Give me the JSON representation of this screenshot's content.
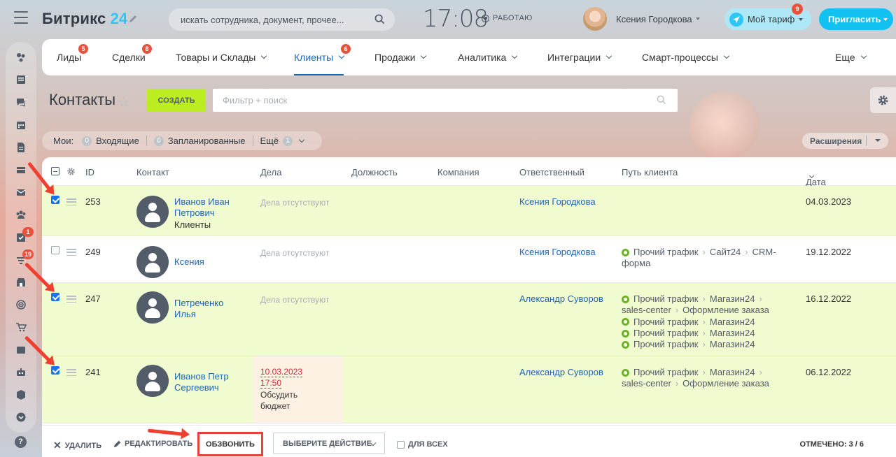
{
  "app": {
    "logo_text": "Битрикс",
    "logo_num": "24"
  },
  "search": {
    "placeholder": "искать сотрудника, документ, прочее..."
  },
  "clock": {
    "time": "17:08",
    "status": "РАБОТАЮ"
  },
  "user": {
    "name": "Ксения Городкова"
  },
  "tariff": {
    "label": "Мой тариф",
    "badge": "9"
  },
  "invite": {
    "label": "Пригласить"
  },
  "sidebar": {
    "badges": {
      "tasks": "1",
      "crm": "19"
    },
    "help": "?"
  },
  "menu": {
    "items": [
      {
        "label": "Лиды",
        "badge": "5"
      },
      {
        "label": "Сделки",
        "badge": "8"
      },
      {
        "label": "Товары и Склады"
      },
      {
        "label": "Клиенты",
        "badge": "6"
      },
      {
        "label": "Продажи"
      },
      {
        "label": "Аналитика"
      },
      {
        "label": "Интеграции"
      },
      {
        "label": "Смарт-процессы"
      },
      {
        "label": "Еще"
      }
    ]
  },
  "toolbar": {
    "title": "Контакты",
    "create": "СОЗДАТЬ",
    "filter_placeholder": "Фильтр + поиск"
  },
  "counters": {
    "mine": "Мои:",
    "incoming_count": "0",
    "incoming": "Входящие",
    "planned_count": "0",
    "planned": "Запланированные",
    "more": "Ещё",
    "more_count": "1"
  },
  "extensions": "Расширения",
  "grid": {
    "columns": {
      "id": "ID",
      "contact": "Контакт",
      "deals": "Дела",
      "position": "Должность",
      "company": "Компания",
      "responsible": "Ответственный",
      "path": "Путь клиента",
      "created": "Дата создания"
    },
    "rows": [
      {
        "id": "253",
        "name_1": "Иванов Иван",
        "name_2": "Петрович",
        "tag": "Клиенты",
        "deals": "Дела отсутствуют",
        "responsible": "Ксения Городкова",
        "created": "04.03.2023"
      },
      {
        "id": "249",
        "name_1": "Ксения",
        "deals": "Дела отсутствуют",
        "responsible": "Ксения Городкова",
        "path_1": "Прочий трафик",
        "path_2": "Сайт24",
        "path_3": "CRM-",
        "path_4": "форма",
        "created": "19.12.2022"
      },
      {
        "id": "247",
        "name_1": "Петреченко",
        "name_2": "Илья",
        "deals": "Дела отсутствуют",
        "responsible": "Александр Суворов",
        "path_a1": "Прочий трафик",
        "path_a2": "Магазин24",
        "path_a3": "sales-center",
        "path_a4": "Оформление заказа",
        "path_b1": "Прочий трафик",
        "path_b2": "Магазин24",
        "path_c1": "Прочий трафик",
        "path_c2": "Магазин24",
        "path_d1": "Прочий трафик",
        "path_d2": "Магазин24",
        "created": "16.12.2022"
      },
      {
        "id": "241",
        "name_1": "Иванов Петр",
        "name_2": "Сергеевич",
        "deal_date": "10.03.2023",
        "deal_time": "17:50",
        "deal_text_1": "Обсудить",
        "deal_text_2": "бюджет",
        "responsible": "Александр Суворов",
        "path_1": "Прочий трафик",
        "path_2": "Магазин24",
        "path_3": "sales-center",
        "path_4": "Оформление заказа",
        "created": "06.12.2022"
      }
    ]
  },
  "actions": {
    "delete": "УДАЛИТЬ",
    "edit": "РЕДАКТИРОВАТЬ",
    "call": "ОБЗВОНИТЬ",
    "choose": "ВЫБЕРИТЕ ДЕЙСТВИЕ",
    "for_all": "ДЛЯ ВСЕХ",
    "marked": "ОТМЕЧЕНО: 3 / 6"
  },
  "colors": {
    "accent": "#2066b0",
    "create": "#bbed21",
    "selected_row": "#f1fbd0",
    "arrow": "#ef3f31",
    "badge": "#e8523c"
  }
}
